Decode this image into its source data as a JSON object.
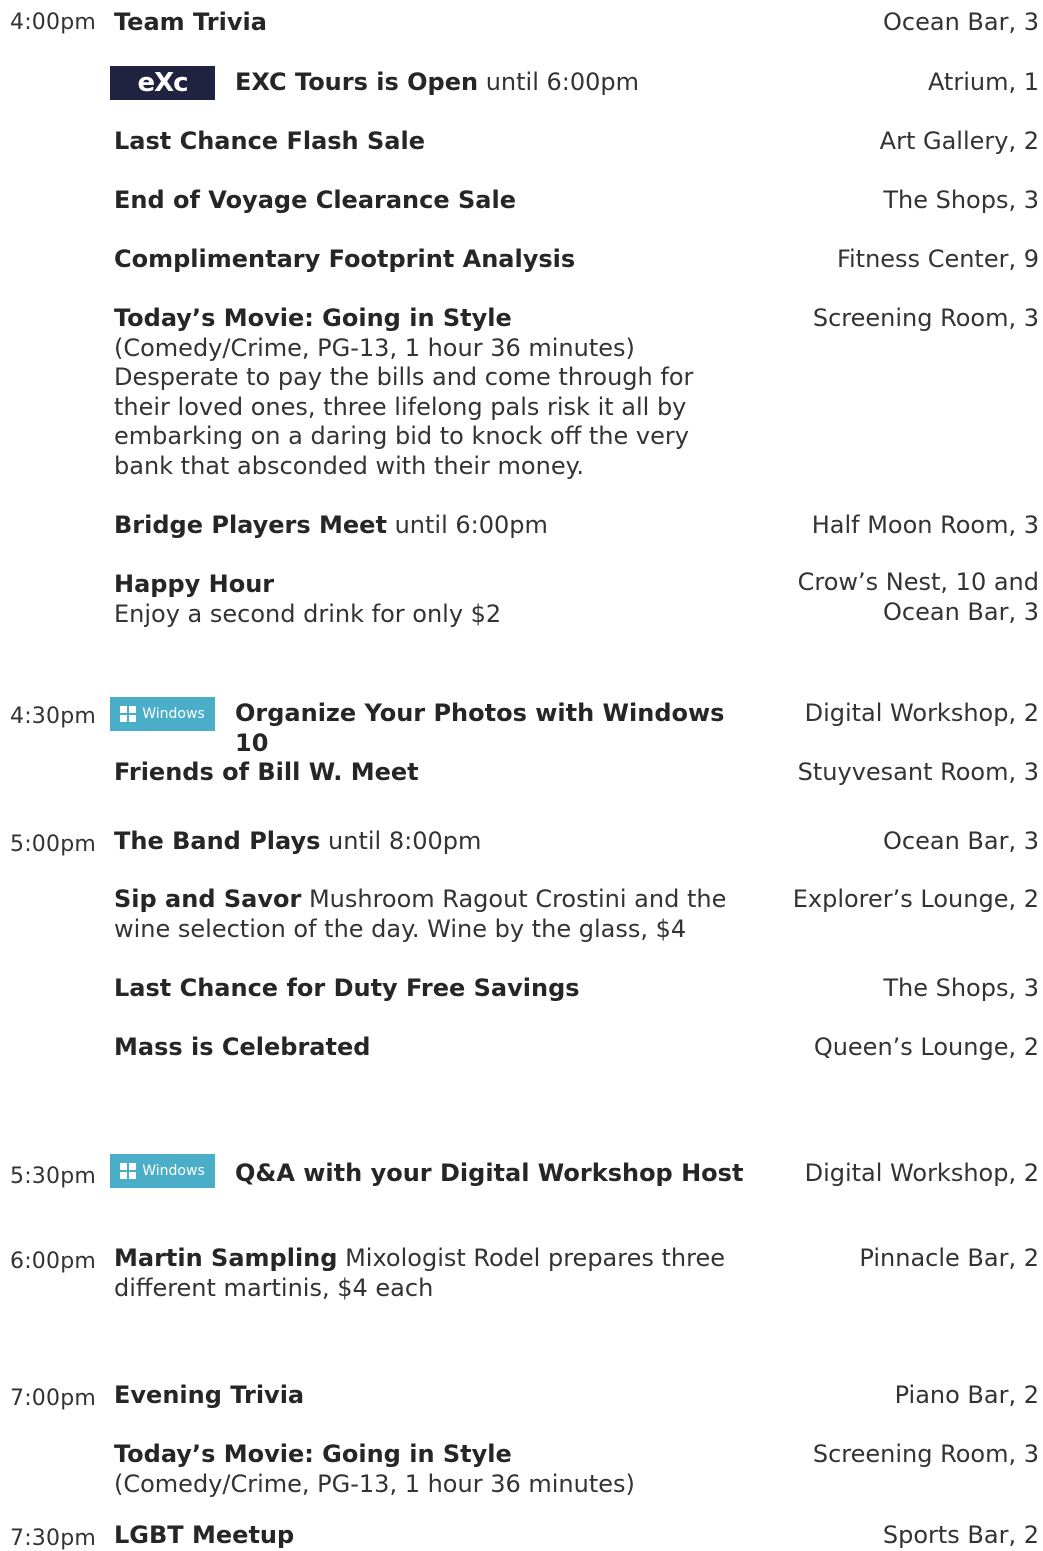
{
  "schedule": {
    "r0": {
      "time": "4:00pm",
      "title": "Team Trivia",
      "location": "Ocean Bar, 3"
    },
    "r1": {
      "logo": "eXc",
      "title": "EXC Tours is Open",
      "detail": " until 6:00pm",
      "location": "Atrium, 1"
    },
    "r2": {
      "title": "Last Chance Flash Sale",
      "location": "Art Gallery, 2"
    },
    "r3": {
      "title": "End of Voyage Clearance Sale",
      "location": "The Shops, 3"
    },
    "r4": {
      "title": "Complimentary Footprint Analysis",
      "location": "Fitness Center, 9"
    },
    "r5": {
      "title": "Today’s Movie: Going in Style",
      "line1": "(Comedy/Crime, PG-13, 1 hour 36 minutes)",
      "line2": "Desperate to pay the bills and come through for",
      "line3": "their loved ones, three lifelong pals risk it all by",
      "line4": "embarking on a daring bid to knock off the very",
      "line5": "bank that absconded with their money.",
      "location": "Screening Room, 3"
    },
    "r6": {
      "title": "Bridge Players Meet",
      "detail": " until 6:00pm",
      "location": "Half Moon Room, 3"
    },
    "r7": {
      "title": "Happy Hour",
      "desc": "Enjoy a second drink for only $2",
      "location_line1": "Crow’s Nest, 10 and",
      "location_line2": "Ocean Bar, 3"
    },
    "r8": {
      "time": "4:30pm",
      "logo": "Windows",
      "title": "Organize Your Photos with Windows 10",
      "location": "Digital Workshop, 2"
    },
    "r9": {
      "title": "Friends of Bill W. Meet",
      "location": "Stuyvesant Room, 3"
    },
    "r10": {
      "time": "5:00pm",
      "title": "The Band Plays",
      "detail": " until 8:00pm",
      "location": "Ocean Bar, 3"
    },
    "r11": {
      "title": "Sip and Savor",
      "detail1": " Mushroom Ragout Crostini and the",
      "detail2": "wine selection of the day. Wine by the glass, $4",
      "location": "Explorer’s Lounge, 2"
    },
    "r12": {
      "title": "Last Chance for Duty Free Savings",
      "location": "The Shops, 3"
    },
    "r13": {
      "title": "Mass is Celebrated",
      "location": "Queen’s Lounge, 2"
    },
    "r14": {
      "time": "5:30pm",
      "logo": "Windows",
      "title": "Q&A with your Digital Workshop Host",
      "location": "Digital Workshop, 2"
    },
    "r15": {
      "time": "6:00pm",
      "title": "Martin Sampling",
      "detail1": " Mixologist Rodel prepares three",
      "detail2": "different martinis, $4 each",
      "location": "Pinnacle Bar, 2"
    },
    "r16": {
      "time": "7:00pm",
      "title": "Evening Trivia",
      "location": "Piano Bar, 2"
    },
    "r17": {
      "title": "Today’s Movie: Going in Style",
      "line1": "(Comedy/Crime, PG-13, 1 hour 36 minutes)",
      "location": "Screening Room, 3"
    },
    "r18": {
      "time": "7:30pm",
      "title": "LGBT Meetup",
      "location": "Sports Bar, 2"
    }
  }
}
